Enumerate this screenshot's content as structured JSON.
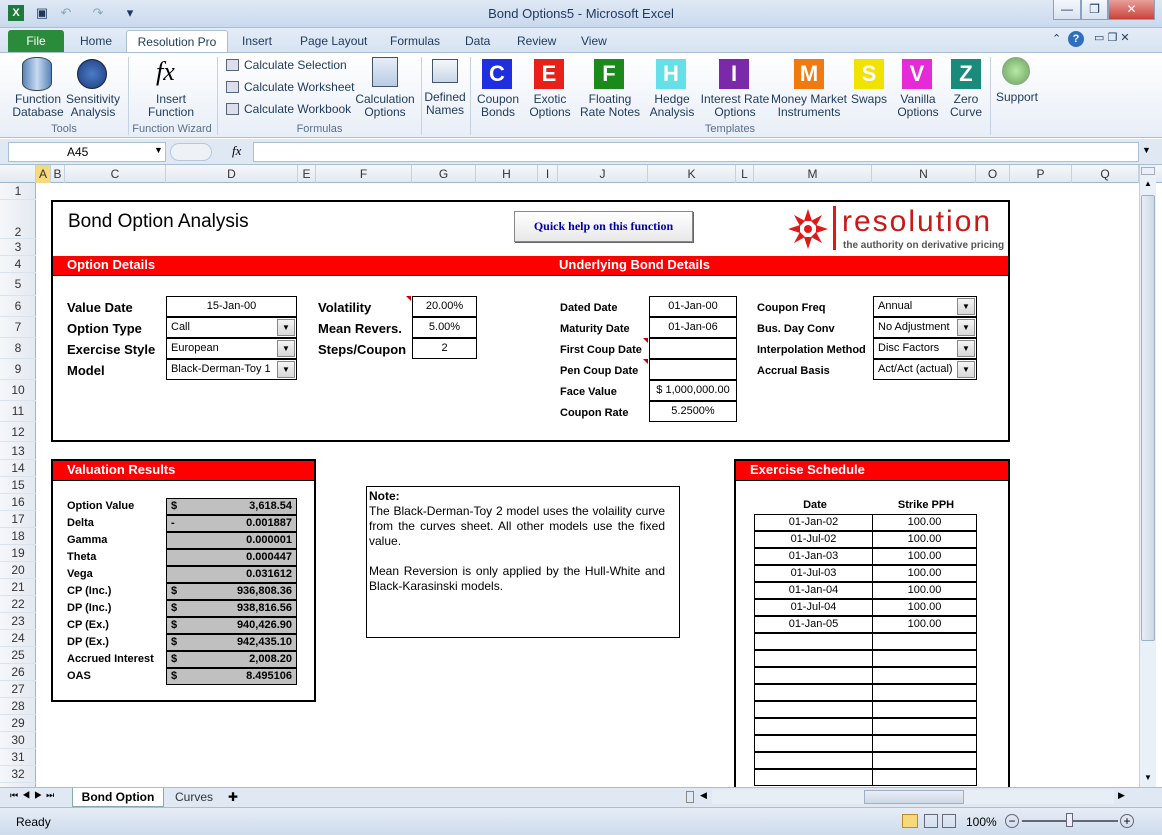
{
  "window": {
    "title": "Bond Options5 - Microsoft Excel"
  },
  "qat": {
    "icons": [
      "excel-icon",
      "save-icon",
      "undo-icon",
      "redo-icon",
      "customize-icon"
    ]
  },
  "tabs": [
    "File",
    "Home",
    "Resolution Pro",
    "Insert",
    "Page Layout",
    "Formulas",
    "Data",
    "Review",
    "View"
  ],
  "ribbon": {
    "tools": {
      "function_database": "Function\nDatabase",
      "sensitivity_analysis": "Sensitivity\nAnalysis",
      "group": "Tools"
    },
    "wizard": {
      "insert_function": "Insert\nFunction",
      "group": "Function Wizard"
    },
    "formulas": {
      "calc_selection": "Calculate Selection",
      "calc_worksheet": "Calculate Worksheet",
      "calc_workbook": "Calculate Workbook",
      "calc_options": "Calculation\nOptions",
      "group": "Formulas"
    },
    "defined_names": "Defined\nNames",
    "templates": [
      {
        "letter": "C",
        "color": "#1f2fe0",
        "label": "Coupon\nBonds"
      },
      {
        "letter": "E",
        "color": "#e8201a",
        "label": "Exotic\nOptions"
      },
      {
        "letter": "F",
        "color": "#1a8a1a",
        "label": "Floating\nRate Notes"
      },
      {
        "letter": "H",
        "color": "#66e0e8",
        "label": "Hedge\nAnalysis"
      },
      {
        "letter": "I",
        "color": "#7a2aa8",
        "label": "Interest Rate\nOptions"
      },
      {
        "letter": "M",
        "color": "#f07a10",
        "label": "Money Market\nInstruments"
      },
      {
        "letter": "S",
        "color": "#f2e200",
        "label": "Swaps"
      },
      {
        "letter": "V",
        "color": "#e62ad8",
        "label": "Vanilla\nOptions"
      },
      {
        "letter": "Z",
        "color": "#1a8a7a",
        "label": "Zero\nCurve"
      }
    ],
    "templates_group": "Templates",
    "support": "Support"
  },
  "formula_bar": {
    "name_box": "A45",
    "fx": "fx",
    "formula": ""
  },
  "columns": [
    "A",
    "B",
    "C",
    "D",
    "E",
    "F",
    "G",
    "H",
    "I",
    "J",
    "K",
    "L",
    "M",
    "N",
    "O",
    "P",
    "Q"
  ],
  "rows": [
    "1",
    "2",
    "3",
    "4",
    "5",
    "6",
    "7",
    "8",
    "9",
    "10",
    "11",
    "12",
    "13",
    "14",
    "15",
    "16",
    "17",
    "18",
    "19",
    "20",
    "21",
    "22",
    "23",
    "24",
    "25",
    "26",
    "27",
    "28",
    "29",
    "30",
    "31",
    "32"
  ],
  "sheet": {
    "title": "Bond Option Analysis",
    "help_button": "Quick help on this function",
    "logo": {
      "name": "resolution",
      "tagline": "the authority on derivative pricing"
    },
    "option_details": {
      "header": "Option Details",
      "value_date": {
        "label": "Value Date",
        "value": "15-Jan-00"
      },
      "option_type": {
        "label": "Option Type",
        "value": "Call"
      },
      "exercise_style": {
        "label": "Exercise Style",
        "value": "European"
      },
      "model": {
        "label": "Model",
        "value": "Black-Derman-Toy 1"
      },
      "volatility": {
        "label": "Volatility",
        "value": "20.00%"
      },
      "mean_revers": {
        "label": "Mean Revers.",
        "value": "5.00%"
      },
      "steps_coupon": {
        "label": "Steps/Coupon",
        "value": "2"
      }
    },
    "bond_details": {
      "header": "Underlying Bond Details",
      "dated_date": {
        "label": "Dated Date",
        "value": "01-Jan-00"
      },
      "maturity_date": {
        "label": "Maturity Date",
        "value": "01-Jan-06"
      },
      "first_coup": {
        "label": "First Coup Date",
        "value": ""
      },
      "pen_coup": {
        "label": "Pen Coup Date",
        "value": ""
      },
      "face_value": {
        "label": "Face Value",
        "value": "$ 1,000,000.00"
      },
      "coupon_rate": {
        "label": "Coupon Rate",
        "value": "5.2500%"
      },
      "coupon_freq": {
        "label": "Coupon Freq",
        "value": "Annual"
      },
      "bus_day": {
        "label": "Bus. Day Conv",
        "value": "No Adjustment"
      },
      "interp": {
        "label": "Interpolation Method",
        "value": "Disc Factors"
      },
      "accrual": {
        "label": "Accrual Basis",
        "value": "Act/Act (actual)"
      }
    },
    "valuation": {
      "header": "Valuation Results",
      "rows": [
        {
          "label": "Option Value",
          "cur": "$",
          "value": "3,618.54"
        },
        {
          "label": "Delta",
          "cur": "-",
          "value": "0.001887"
        },
        {
          "label": "Gamma",
          "cur": "",
          "value": "0.000001"
        },
        {
          "label": "Theta",
          "cur": "",
          "value": "0.000447"
        },
        {
          "label": "Vega",
          "cur": "",
          "value": "0.031612"
        },
        {
          "label": "CP (Inc.)",
          "cur": "$",
          "value": "936,808.36"
        },
        {
          "label": "DP (Inc.)",
          "cur": "$",
          "value": "938,816.56"
        },
        {
          "label": "CP (Ex.)",
          "cur": "$",
          "value": "940,426.90"
        },
        {
          "label": "DP (Ex.)",
          "cur": "$",
          "value": "942,435.10"
        },
        {
          "label": "Accrued Interest",
          "cur": "$",
          "value": "2,008.20"
        },
        {
          "label": "OAS",
          "cur": "$",
          "value": "8.495106"
        }
      ]
    },
    "note": {
      "title": "Note:",
      "p1": "The Black-Derman-Toy 2 model uses the volaility curve from the curves sheet. All other models use the fixed value.",
      "p2": "Mean Reversion is only applied by the Hull-White and Black-Karasinski models."
    },
    "exercise": {
      "header": "Exercise Schedule",
      "col_date": "Date",
      "col_strike": "Strike PPH",
      "rows": [
        {
          "date": "01-Jan-02",
          "strike": "100.00"
        },
        {
          "date": "01-Jul-02",
          "strike": "100.00"
        },
        {
          "date": "01-Jan-03",
          "strike": "100.00"
        },
        {
          "date": "01-Jul-03",
          "strike": "100.00"
        },
        {
          "date": "01-Jan-04",
          "strike": "100.00"
        },
        {
          "date": "01-Jul-04",
          "strike": "100.00"
        },
        {
          "date": "01-Jan-05",
          "strike": "100.00"
        },
        {
          "date": "",
          "strike": ""
        },
        {
          "date": "",
          "strike": ""
        },
        {
          "date": "",
          "strike": ""
        },
        {
          "date": "",
          "strike": ""
        },
        {
          "date": "",
          "strike": ""
        },
        {
          "date": "",
          "strike": ""
        },
        {
          "date": "",
          "strike": ""
        },
        {
          "date": "",
          "strike": ""
        },
        {
          "date": "",
          "strike": ""
        }
      ]
    }
  },
  "sheet_tabs": [
    "Bond Option",
    "Curves"
  ],
  "status": {
    "ready": "Ready",
    "zoom": "100%"
  }
}
